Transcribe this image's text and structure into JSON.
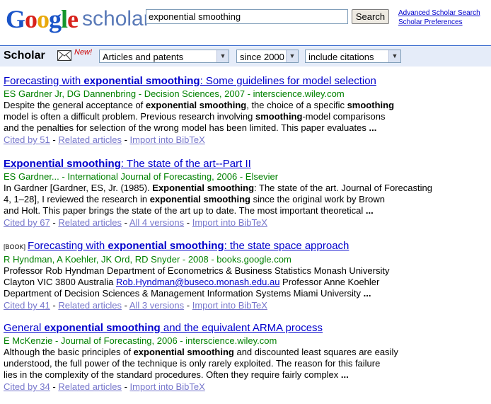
{
  "logo": {
    "text": "Google",
    "suffix": "scholar"
  },
  "search": {
    "query": "exponential smoothing",
    "button": "Search"
  },
  "top_links": {
    "advanced": "Advanced Scholar Search",
    "preferences": "Scholar Preferences"
  },
  "bar": {
    "title": "Scholar",
    "new_label": "New!",
    "select_type": "Articles and patents",
    "select_year": "since 2000",
    "select_citations": "include citations"
  },
  "results": [
    {
      "tag": "",
      "title_pre": "Forecasting with ",
      "title_bold": "exponential smoothing",
      "title_post": ": Some guidelines for model selection",
      "meta": "ES Gardner Jr, DG Dannenbring - Decision Sciences, 2007 - interscience.wiley.com",
      "snippet_lines": [
        [
          "Despite the general acceptance of ",
          "exponential smoothing",
          ", the choice of a specific ",
          "smoothing",
          ""
        ],
        [
          "model is often a difficult problem. Previous research involving ",
          "smoothing",
          "-model comparisons",
          "",
          ""
        ],
        [
          "and the penalties for selection of the wrong model has been limited. This paper evaluates ",
          "...",
          "",
          "",
          ""
        ]
      ],
      "links": [
        "Cited by 51",
        "Related articles",
        "Import into BibTeX"
      ]
    },
    {
      "tag": "",
      "title_pre": "",
      "title_bold": "Exponential smoothing",
      "title_post": ": The state of the art--Part II",
      "meta": "ES Gardner... - International Journal of Forecasting, 2006 - Elsevier",
      "snippet_lines": [
        [
          "In Gardner [Gardner, ES, Jr. (1985). ",
          "Exponential smoothing",
          ": The state of the art. Journal of Forecasting",
          "",
          ""
        ],
        [
          "4, 1–28], I reviewed the research in ",
          "exponential smoothing",
          " since the original work by Brown",
          "",
          ""
        ],
        [
          "and Holt. This paper brings the state of the art up to date. The most important theoretical ",
          "...",
          "",
          "",
          ""
        ]
      ],
      "links": [
        "Cited by 67",
        "Related articles",
        "All 4 versions",
        "Import into BibTeX"
      ]
    },
    {
      "tag": "[BOOK]",
      "title_pre": "Forecasting with ",
      "title_bold": "exponential smoothing",
      "title_post": ": the state space approach",
      "meta": "R Hyndman, A Koehler, JK Ord, RD Snyder - 2008 - books.google.com",
      "snippet_lines": [
        [
          "Professor Rob Hyndman Department of Econometrics & Business Statistics Monash University",
          "",
          "",
          "",
          ""
        ],
        [
          "Clayton VIC 3800 Australia ",
          "",
          "",
          "",
          ""
        ],
        [
          "Department of Decision Sciences & Management Information Systems Miami University ",
          "...",
          "",
          "",
          ""
        ]
      ],
      "email": "Rob.Hyndman@buseco.monash.edu.au",
      "email_after": " Professor Anne Koehler",
      "links": [
        "Cited by 41",
        "Related articles",
        "All 3 versions",
        "Import into BibTeX"
      ]
    },
    {
      "tag": "",
      "title_pre": "General ",
      "title_bold": "exponential smoothing",
      "title_post": " and the equivalent ARMA process",
      "meta": "E McKenzie - Journal of Forecasting, 2006 - interscience.wiley.com",
      "snippet_lines": [
        [
          "Although the basic principles of ",
          "exponential smoothing",
          " and discounted least squares are easily",
          "",
          ""
        ],
        [
          "understood, the full power of the technique is only rarely exploited. The reason for this failure",
          "",
          "",
          "",
          ""
        ],
        [
          "lies in the complexity of the standard procedures. Often they require fairly complex ",
          "...",
          "",
          "",
          ""
        ]
      ],
      "links": [
        "Cited by 34",
        "Related articles",
        "Import into BibTeX"
      ]
    }
  ]
}
